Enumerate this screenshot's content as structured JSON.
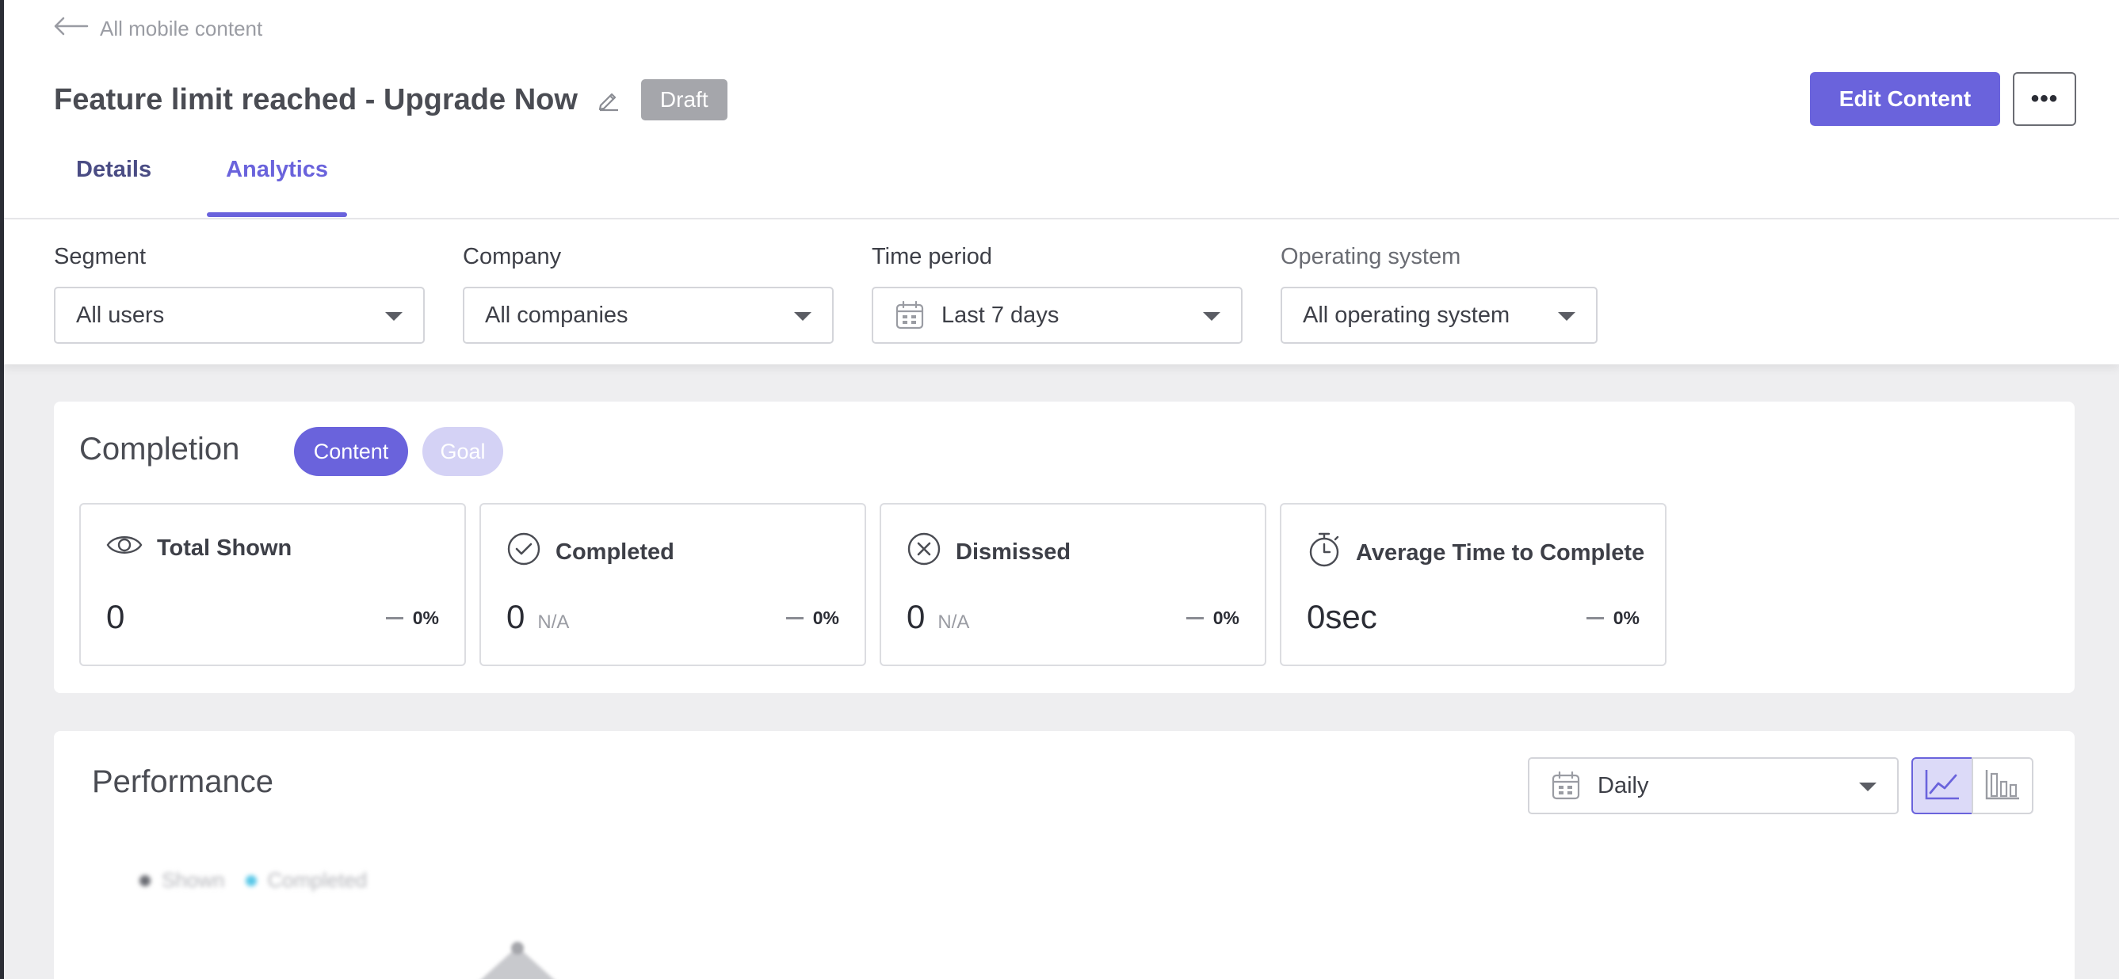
{
  "nav": {
    "back_label": "All mobile content"
  },
  "header": {
    "title": "Feature limit reached - Upgrade Now",
    "status_badge": "Draft",
    "edit_button": "Edit Content",
    "more_button": "•••"
  },
  "tabs": [
    {
      "label": "Details",
      "active": false
    },
    {
      "label": "Analytics",
      "active": true
    }
  ],
  "filters": {
    "segment": {
      "label": "Segment",
      "value": "All users"
    },
    "company": {
      "label": "Company",
      "value": "All companies"
    },
    "time_period": {
      "label": "Time period",
      "value": "Last 7 days"
    },
    "os": {
      "label": "Operating system",
      "value": "All operating system"
    }
  },
  "completion": {
    "title": "Completion",
    "pills": {
      "content": "Content",
      "goal": "Goal"
    },
    "stats": [
      {
        "label": "Total Shown",
        "icon": "eye-icon",
        "value": "0",
        "sub": "",
        "change": "0%"
      },
      {
        "label": "Completed",
        "icon": "check-circle-icon",
        "value": "0",
        "sub": "N/A",
        "change": "0%"
      },
      {
        "label": "Dismissed",
        "icon": "x-circle-icon",
        "value": "0",
        "sub": "N/A",
        "change": "0%"
      },
      {
        "label": "Average Time to Complete",
        "icon": "stopwatch-icon",
        "value": "0sec",
        "sub": "",
        "change": "0%"
      }
    ]
  },
  "performance": {
    "title": "Performance",
    "interval": "Daily",
    "legend": {
      "shown": "Shown",
      "completed": "Completed"
    }
  },
  "colors": {
    "accent": "#6a63dc",
    "accent_light": "#d4d2f5",
    "badge": "#a5a6ab"
  }
}
